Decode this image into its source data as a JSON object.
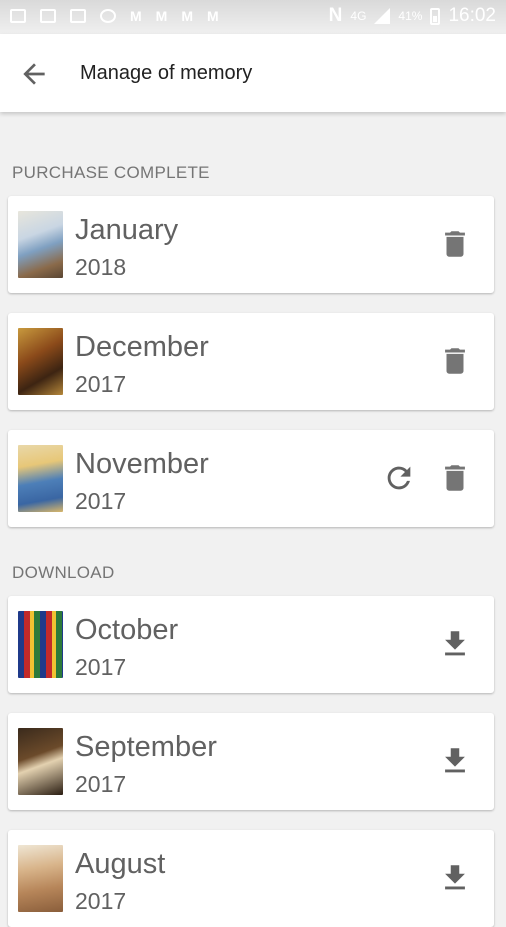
{
  "status_bar": {
    "network": "4G",
    "battery": "41%",
    "time": "16:02",
    "notification_letters": [
      "M",
      "M",
      "M",
      "M"
    ],
    "nfc": "N"
  },
  "app_bar": {
    "back_icon": "arrow-back-icon",
    "title": "Manage of memory"
  },
  "sections": {
    "purchase": {
      "title": "PURCHASE COMPLETE",
      "items": [
        {
          "month": "January",
          "year": "2018",
          "actions": [
            "delete-icon"
          ]
        },
        {
          "month": "December",
          "year": "2017",
          "actions": [
            "delete-icon"
          ]
        },
        {
          "month": "November",
          "year": "2017",
          "actions": [
            "refresh-icon",
            "delete-icon"
          ]
        }
      ]
    },
    "download": {
      "title": "DOWNLOAD",
      "items": [
        {
          "month": "October",
          "year": "2017",
          "actions": [
            "download-icon"
          ]
        },
        {
          "month": "September",
          "year": "2017",
          "actions": [
            "download-icon"
          ]
        },
        {
          "month": "August",
          "year": "2017",
          "actions": [
            "download-icon"
          ]
        }
      ]
    }
  },
  "colors": {
    "background": "#f1f1f1",
    "card": "#ffffff",
    "text_primary": "#616161",
    "section_title": "#757575",
    "icon": "#616161"
  }
}
